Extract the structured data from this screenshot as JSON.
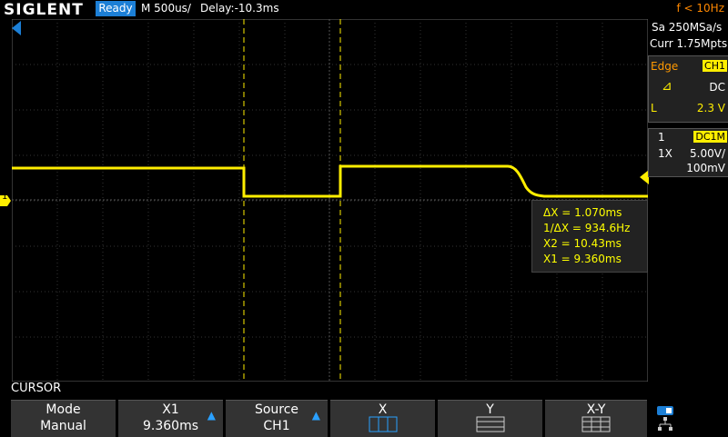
{
  "header": {
    "logo": "SIGLENT",
    "status": "Ready",
    "timebase": "M 500us/",
    "delay": "Delay:-10.3ms",
    "freq": "f < 10Hz"
  },
  "acquisition": {
    "sample_rate": "Sa 250MSa/s",
    "curr": "Curr 1.75Mpts"
  },
  "trigger": {
    "type": "Edge",
    "source": "CH1",
    "coupling": "DC",
    "level_prefix": "L",
    "level": "2.3 V"
  },
  "channel": {
    "number": "1",
    "coupling_badge": "DC1M",
    "probe": "1X",
    "volts_div": "5.00V/",
    "offset": "100mV"
  },
  "measurements": {
    "delta_x": "ΔX = 1.070ms",
    "inv_delta_x": "1/ΔX = 934.6Hz",
    "x2": "X2 = 10.43ms",
    "x1": "X1 = 9.360ms"
  },
  "bottom": {
    "menu_title": "CURSOR",
    "softkeys": [
      {
        "line1": "Mode",
        "line2": "Manual"
      },
      {
        "line1": "X1",
        "line2": "9.360ms"
      },
      {
        "line1": "Source",
        "line2": "CH1"
      },
      {
        "line1": "X",
        "line2": ""
      },
      {
        "line1": "Y",
        "line2": ""
      },
      {
        "line1": "X-Y",
        "line2": ""
      }
    ]
  },
  "markers": {
    "channel_marker": "1"
  },
  "colors": {
    "trace": "#ffee00",
    "accent": "#1c7fd6",
    "freq": "#ff8800"
  }
}
